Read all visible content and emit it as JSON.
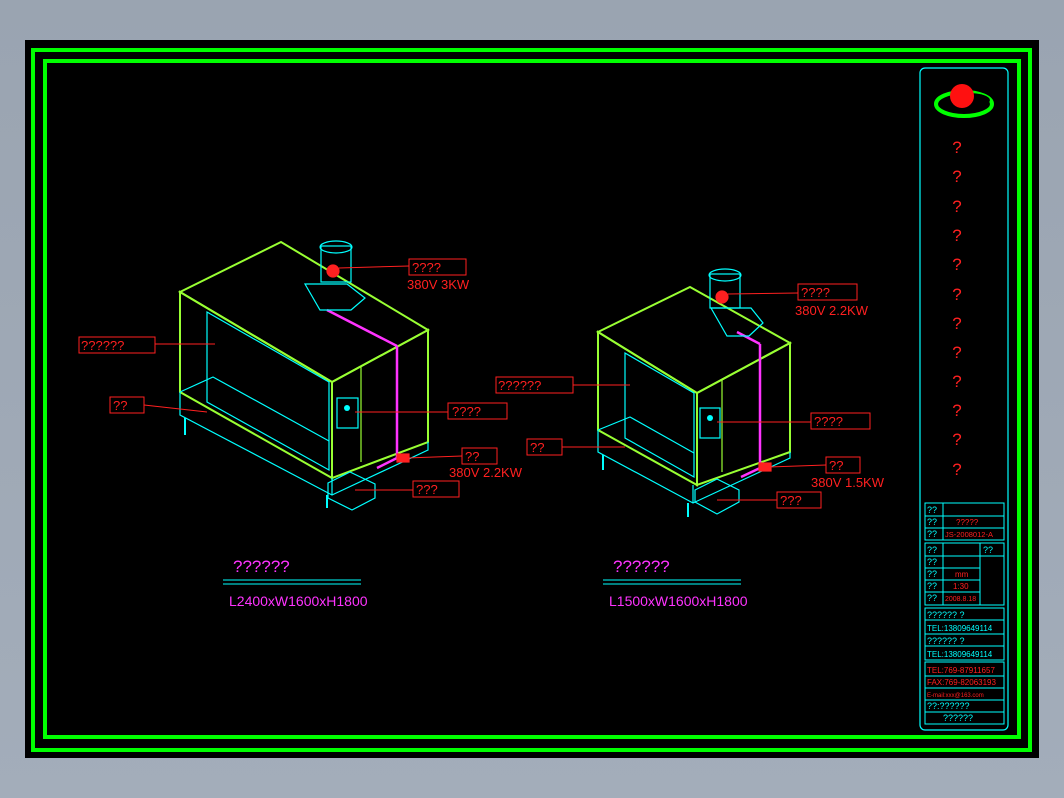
{
  "colors": {
    "background": "#000000",
    "frame": "#00ff00",
    "outline": "#00ffff",
    "annotation": "#ff0000",
    "title": "#ff00ff",
    "cabinet": "#99ff33"
  },
  "machine_left": {
    "title": "??????",
    "dimension": "L2400xW1600xH1800",
    "labels": {
      "fan": "????",
      "fan_spec": "380V 3KW",
      "body": "??????",
      "base": "??",
      "control": "????",
      "pump": "??",
      "pump_spec": "380V 2.2KW",
      "tank": "???"
    }
  },
  "machine_right": {
    "title": "??????",
    "dimension": "L1500xW1600xH1800",
    "labels": {
      "fan": "????",
      "fan_spec": "380V 2.2KW",
      "body": "??????",
      "base": "??",
      "control": "????",
      "pump": "??",
      "pump_spec": "380V 1.5KW",
      "tank": "???"
    }
  },
  "title_block": {
    "vertical_text": [
      "?",
      "?",
      "?",
      "?",
      "?",
      "?",
      "?",
      "?",
      "?",
      "?",
      "?",
      "?"
    ],
    "row1_label": "??",
    "row2_label": "??",
    "row2_value": "?????",
    "row3_label": "??",
    "row3_value": "JS-2008012-A",
    "row4_label": "??",
    "row4_label_b": "??",
    "row5_label": "??",
    "row6_label": "??",
    "row6_value": "mm",
    "row7_label": "??",
    "row7_value": "1:30",
    "row8_label": "??",
    "row8_value": "2008.8.18",
    "contact1": "?????? ?",
    "tel1": "TEL:13809649114",
    "contact2": "?????? ?",
    "tel2": "TEL:13809649114",
    "company_tel": "TEL:769-87911657",
    "company_fax": "FAX:769-82063193",
    "email": "E-mail:xxx@163.com",
    "addr": "??:??????",
    "company": "??????"
  }
}
